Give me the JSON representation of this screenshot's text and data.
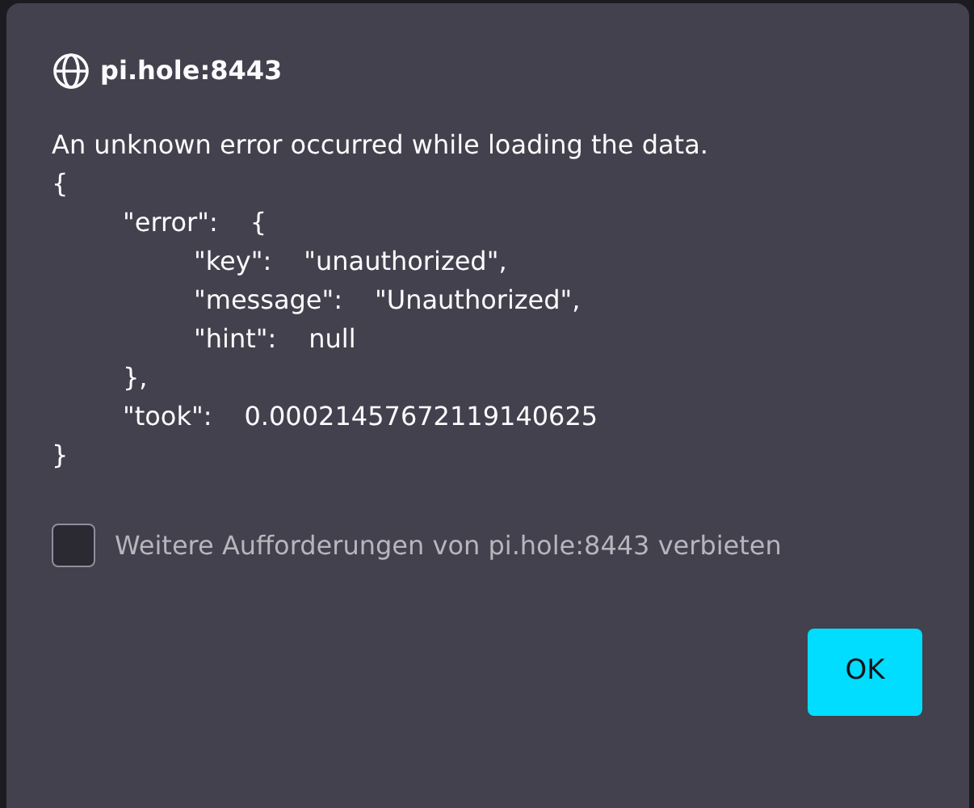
{
  "dialog": {
    "title": "pi.hole:8443",
    "intro": "An unknown error occurred while loading the data.",
    "lines": [
      {
        "text": "{",
        "close": "}",
        "children": [
          {
            "key": "\"error\":",
            "value": "{",
            "close": "},",
            "children": [
              {
                "key": "\"key\":",
                "value": "\"unauthorized\","
              },
              {
                "key": "\"message\":",
                "value": "\"Unauthorized\","
              },
              {
                "key": "\"hint\":",
                "value": "null"
              }
            ]
          },
          {
            "key": "\"took\":",
            "value": "0.00021457672119140625"
          }
        ]
      }
    ],
    "suppress_checkbox": {
      "label": "Weitere Aufforderungen von pi.hole:8443 verbieten",
      "checked": false
    },
    "buttons": [
      "OK"
    ]
  }
}
